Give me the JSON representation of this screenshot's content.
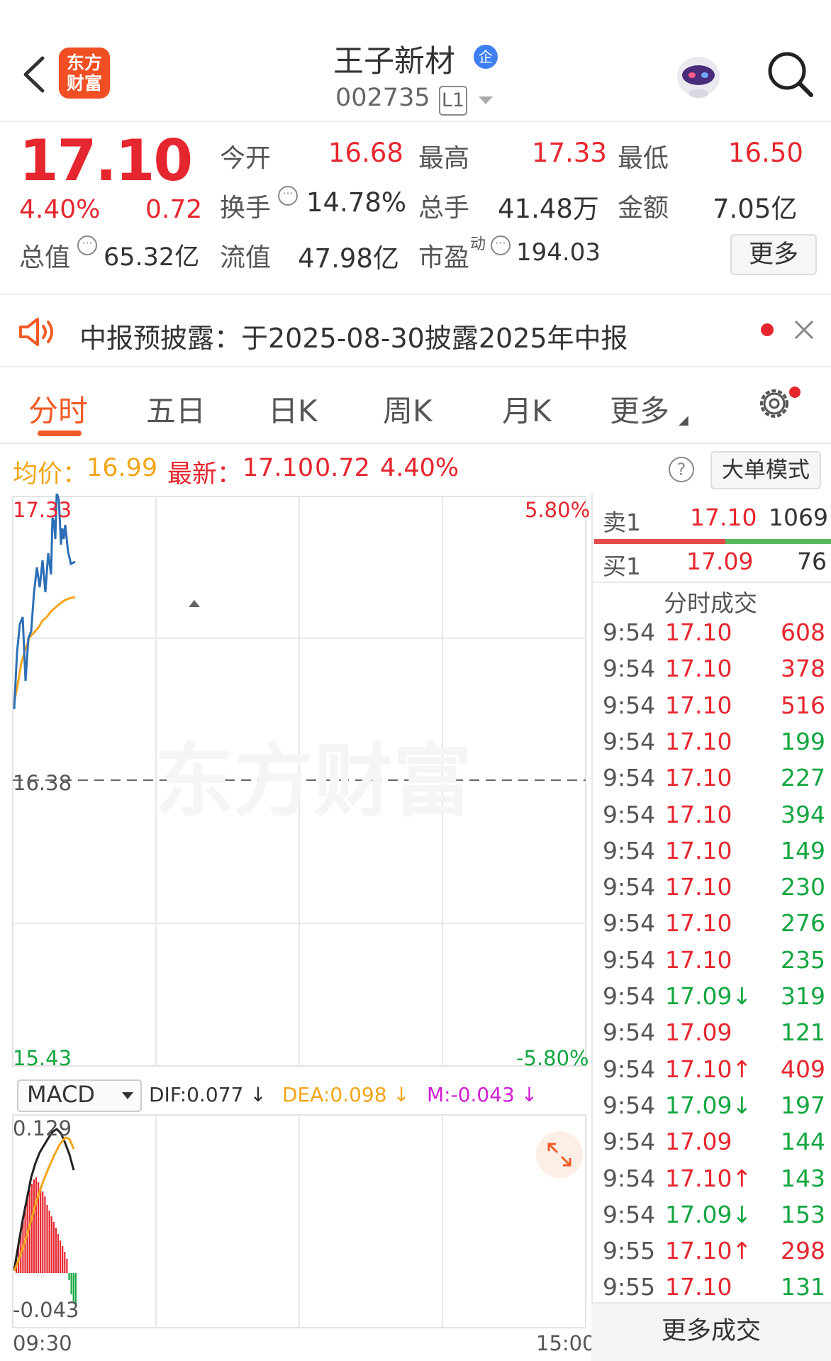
{
  "header": {
    "logo_line1": "东方",
    "logo_line2": "财富",
    "stock_name": "王子新材",
    "enterprise_badge": "企",
    "stock_code": "002735",
    "level": "L1"
  },
  "quote": {
    "price": "17.10",
    "change_pct": "4.40%",
    "change": "0.72",
    "open_label": "今开",
    "open": "16.68",
    "high_label": "最高",
    "high": "17.33",
    "low_label": "最低",
    "low": "16.50",
    "turnover_label": "换手",
    "turnover": "14.78%",
    "volume_label": "总手",
    "volume": "41.48万",
    "amount_label": "金额",
    "amount": "7.05亿",
    "mktcap_label": "总值",
    "mktcap": "65.32亿",
    "float_label": "流值",
    "float_cap": "47.98亿",
    "pe_label": "市盈",
    "pe_sup": "动",
    "pe": "194.03",
    "more_button": "更多"
  },
  "notice": {
    "text": "中报预披露：于2025-08-30披露2025年中报"
  },
  "tabs": [
    "分时",
    "五日",
    "日K",
    "周K",
    "月K",
    "更多"
  ],
  "status": {
    "avg_label": "均价：",
    "avg": "16.99",
    "latest_label": "最新：",
    "latest": "17.10",
    "change": "0.72",
    "change_pct": "4.40%",
    "big_order_button": "大单模式"
  },
  "chart_axes": {
    "top_price": "17.33",
    "top_pct": "5.80%",
    "mid_price": "16.38",
    "bottom_price": "15.43",
    "bottom_pct": "-5.80%",
    "watermark": "东方财富",
    "macd_top": "0.129",
    "macd_bottom": "-0.043",
    "time_start": "09:30",
    "time_end": "15:00"
  },
  "macd": {
    "selector": "MACD",
    "dif": "DIF:0.077 ↓",
    "dea": "DEA:0.098 ↓",
    "m": "M:-0.043 ↓"
  },
  "order_book": {
    "sell1_label": "卖1",
    "sell1_price": "17.10",
    "sell1_vol": "1069",
    "buy1_label": "买1",
    "buy1_price": "17.09",
    "buy1_vol": "76"
  },
  "trades_title": "分时成交",
  "trades": [
    {
      "time": "9:54",
      "price": "17.10",
      "vol": "608",
      "color": "red"
    },
    {
      "time": "9:54",
      "price": "17.10",
      "vol": "378",
      "color": "red"
    },
    {
      "time": "9:54",
      "price": "17.10",
      "vol": "516",
      "color": "red"
    },
    {
      "time": "9:54",
      "price": "17.10",
      "vol": "199",
      "color": "green"
    },
    {
      "time": "9:54",
      "price": "17.10",
      "vol": "227",
      "color": "green"
    },
    {
      "time": "9:54",
      "price": "17.10",
      "vol": "394",
      "color": "green"
    },
    {
      "time": "9:54",
      "price": "17.10",
      "vol": "149",
      "color": "green"
    },
    {
      "time": "9:54",
      "price": "17.10",
      "vol": "230",
      "color": "green"
    },
    {
      "time": "9:54",
      "price": "17.10",
      "vol": "276",
      "color": "green"
    },
    {
      "time": "9:54",
      "price": "17.10",
      "vol": "235",
      "color": "green"
    },
    {
      "time": "9:54",
      "price": "17.09↓",
      "vol": "319",
      "color": "green"
    },
    {
      "time": "9:54",
      "price": "17.09",
      "vol": "121",
      "color": "green"
    },
    {
      "time": "9:54",
      "price": "17.10↑",
      "vol": "409",
      "color": "red"
    },
    {
      "time": "9:54",
      "price": "17.09↓",
      "vol": "197",
      "color": "green"
    },
    {
      "time": "9:54",
      "price": "17.09",
      "vol": "144",
      "color": "green"
    },
    {
      "time": "9:54",
      "price": "17.10↑",
      "vol": "143",
      "color": "green"
    },
    {
      "time": "9:54",
      "price": "17.09↓",
      "vol": "153",
      "color": "green"
    },
    {
      "time": "9:55",
      "price": "17.10↑",
      "vol": "298",
      "color": "red"
    },
    {
      "time": "9:55",
      "price": "17.10",
      "vol": "131",
      "color": "green"
    }
  ],
  "more_trades_button": "更多成交",
  "colors": {
    "up": "#e6262e",
    "down": "#13a640",
    "accent": "#f05b26",
    "avg_line": "#f2a51a",
    "price_line": "#2c6fb7"
  }
}
